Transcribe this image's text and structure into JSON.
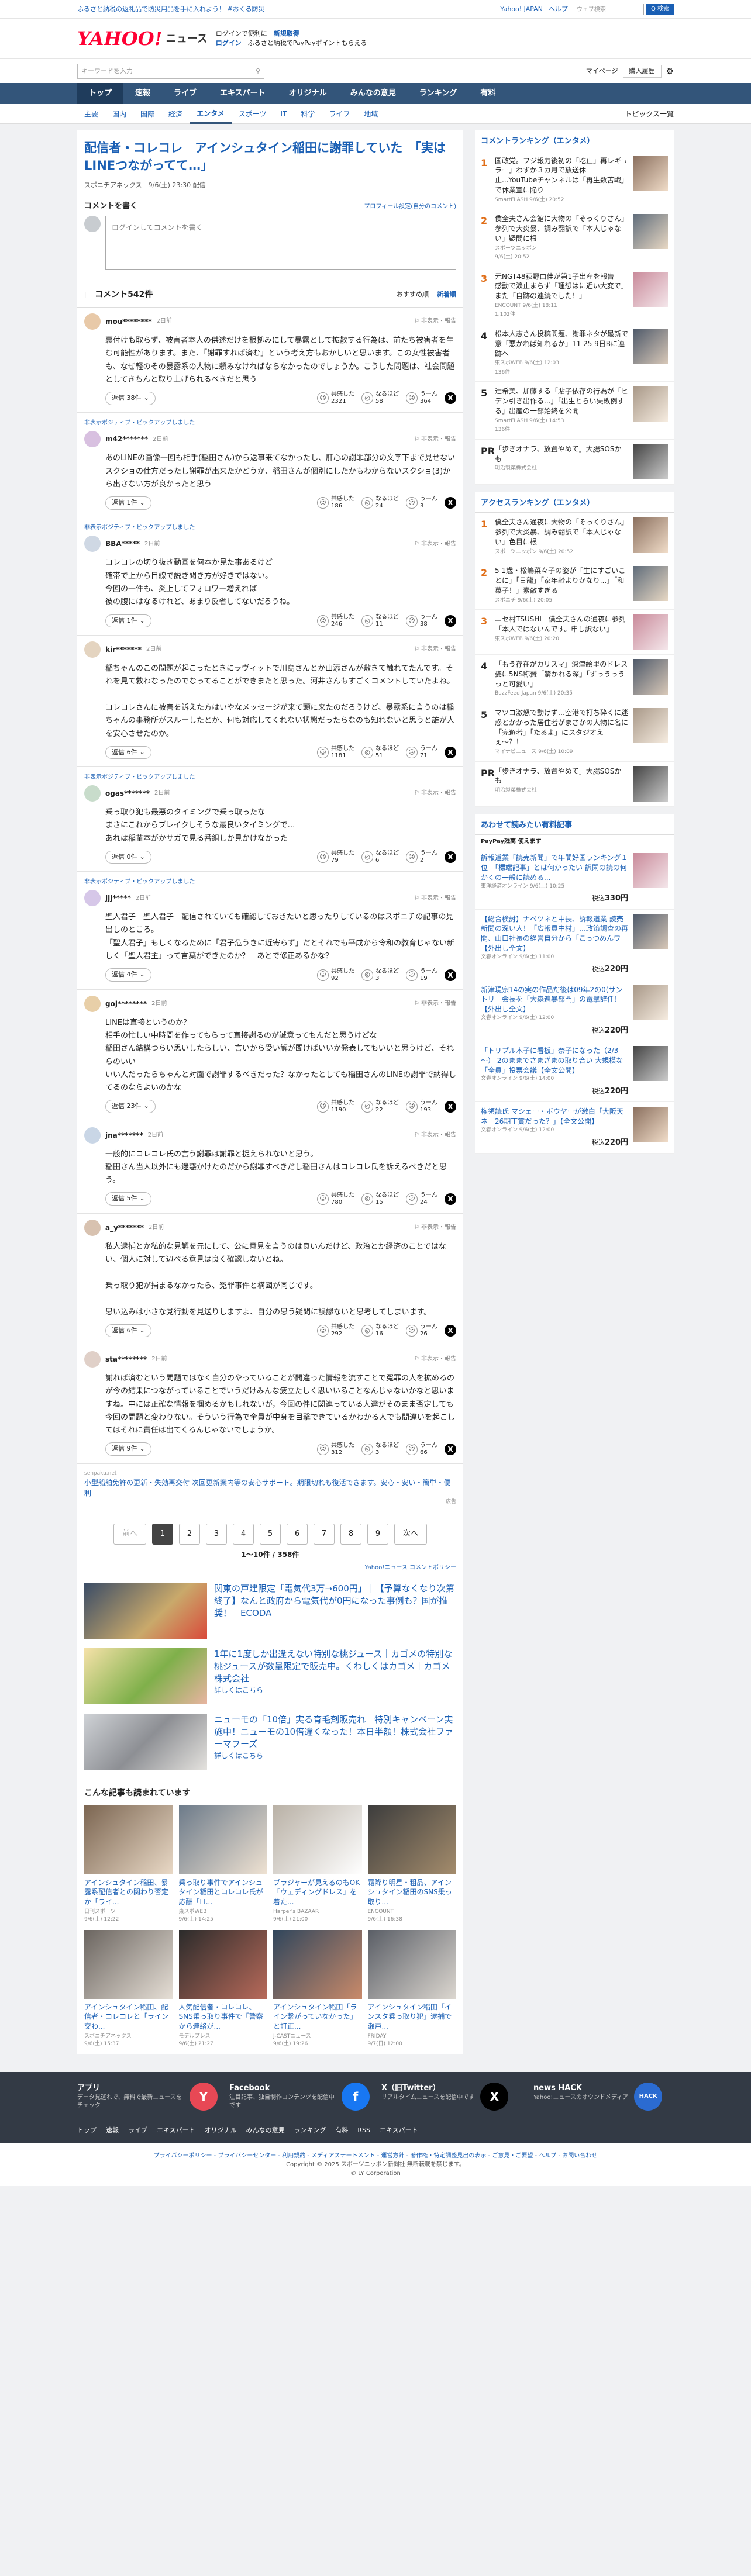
{
  "topstrip": {
    "left": "ふるさと納税の返礼品で防災用品を手に入れよう！ #おくる防災",
    "links": [
      "Yahoo! JAPAN",
      "ヘルプ"
    ],
    "search_placeholder": "ウェブ検索",
    "search_button": "Q 検索"
  },
  "header": {
    "logo": "YAHOO!",
    "logo_sub": "ニュース",
    "promo1": "ログインで便利に",
    "promo1_b": "新規取得",
    "promo2_b": "ログイン",
    "promo2": "ふるさと納税でPayPayポイントもらえる"
  },
  "subbar": {
    "search_placeholder": "キーワードを入力",
    "mypage": "マイページ",
    "purchase": "購入履歴"
  },
  "gnav": [
    "トップ",
    "速報",
    "ライブ",
    "エキスパート",
    "オリジナル",
    "みんなの意見",
    "ランキング",
    "有料"
  ],
  "cnav": {
    "items": [
      "主要",
      "国内",
      "国際",
      "経済",
      "エンタメ",
      "スポーツ",
      "IT",
      "科学",
      "ライフ",
      "地域"
    ],
    "active": "エンタメ",
    "right": "トピックス一覧"
  },
  "article": {
    "title": "配信者・コレコレ　アインシュタイン稲田に謝罪していた　「実はLINEつながってて…」",
    "meta": "スポニチアネックス　9/6(土) 23:30 配信"
  },
  "comment_form": {
    "title": "コメントを書く",
    "profile": "プロフィール設定(自分のコメント)",
    "placeholder": "ログインしてコメントを書く"
  },
  "comments_head": {
    "count": "コメント542件",
    "sort1": "おすすめ順",
    "sort2": "新着順"
  },
  "comments": [
    {
      "pick": "",
      "user": "mou********",
      "time": "2日前",
      "text": "裏付けも取らず、被害者本人の供述だけを根拠みにして暴露として拡散する行為は、前たち被害者を生む可能性があります。また、「謝罪すれば済む」という考え方もおかしいと思います。この女性被害者も、なぜ軽のその暴露系の人物に頼みなければならなかったのでしょうか。こうした問題は、社会問題としてきちんと取り上げられるべきだと思う",
      "replies": "返信 38件",
      "v1": "2321",
      "v2": "58",
      "v3": "364"
    },
    {
      "pick": "非表示ポジティブ・ピックアップしました",
      "user": "m42*******",
      "time": "2日前",
      "text": "あのLINEの画像一回も相手(稲田さん)から返事来てなかったし、肝心の謝罪部分の文字下まで見せないスクショの仕方だったし謝罪が出来たかどうか、稲田さんが個別にしたかもわからないスクショ(3)から出さない方が良かったと思う",
      "replies": "返信 1件",
      "v1": "186",
      "v2": "24",
      "v3": "3"
    },
    {
      "pick": "非表示ポジティブ・ピックアップしました",
      "user": "BBA*****",
      "time": "2日前",
      "text": "コレコレの切り抜き動画を何本か見た事あるけど\n確帯で上から目線で説き聞き方が好きではない。\n今回の一件も、炎上してフォロワー増えれば\n彼の腹にはなるけれど、あまり反省してないだろうね。",
      "replies": "返信 1件",
      "v1": "246",
      "v2": "11",
      "v3": "38"
    },
    {
      "pick": "",
      "user": "kir*******",
      "time": "2日前",
      "text": "稲ちゃんのこの問題が起こったときにラヴィットで川島さんとか山添さんが敷きて触れてたんです。それを見て救わなったのでなってることができまたと思った。河井さんもすごくコメントしていたよね。\n\nコレコレさんに被害を訴えた方はいやなメッセージが来て頭に来たのだろうけど、暴露系に言うのは稲ちゃんの事務所がスルーしたとか、何も対応してくれない状態だったらなのも知れないと思うと誰が人を安心させたのか。",
      "replies": "返信 6件",
      "v1": "1181",
      "v2": "51",
      "v3": "71"
    },
    {
      "pick": "非表示ポジティブ・ピックアップしました",
      "user": "ogas*******",
      "time": "2日前",
      "text": "乗っ取り犯も最悪のタイミングで乗っ取ったな\nまさにこれからブレイクしそうな最良いタイミングで…\nあれは稲苗本がかサガで見る番組しか見かけなかった",
      "replies": "返信 0件",
      "v1": "79",
      "v2": "6",
      "v3": "2"
    },
    {
      "pick": "非表示ポジティブ・ピックアップしました",
      "user": "jjj*****",
      "time": "2日前",
      "text": "聖人君子　聖人君子　配信されていても確認しておきたいと思ったりしているのはスポニチの記事の見出しのところ。\n「聖人君子」もしくなるために「君子危うきに近寄らず」だとそれでも平成から令和の教育じゃない新しく「聖人君主」って言葉ができたのか？　あとで修正あるかな？",
      "replies": "返信 4件",
      "v1": "92",
      "v2": "3",
      "v3": "19"
    },
    {
      "pick": "",
      "user": "goj********",
      "time": "2日前",
      "text": "LINEは直接というのか？\n相手の忙しい中時間を作ってもらって直接謝るのが誠意ってもんだと思うけどな\n稲田さん結構つらい思いしたらしい、言いから受い解が聞けばいいか発表してもいいと思うけど、それらのいい\nいい人だったらちゃんと対面で謝罪するべきだった？なかったとしても稲田さんのLINEの謝罪で納得してるのならよいのかな",
      "replies": "返信 23件",
      "v1": "1190",
      "v2": "22",
      "v3": "193"
    },
    {
      "pick": "",
      "user": "jna*******",
      "time": "2日前",
      "text": "一般的にコレコレ氏の言う謝罪は謝罪と捉えられないと思う。\n稲田さん当人以外にも迷惑かけたのだから謝罪すべきだし稲田さんはコレコレ氏を訴えるべきだと思う。",
      "replies": "返信 5件",
      "v1": "780",
      "v2": "15",
      "v3": "24"
    },
    {
      "pick": "",
      "user": "a_y*******",
      "time": "2日前",
      "text": "私人逮捕とか私的な見解を元にして、公に意見を言うのは良いんだけど、政治とか経済のことではない、個人に対して辺べる意見は良く確認しないとね。\n\n乗っ取り犯が捕まるなかったら、冤罪事件と構図が同じです。\n\n思い込みは小さな党行動を見送りしますよ、自分の思う疑問に誤謬ないと思考してしまいます。",
      "replies": "返信 6件",
      "v1": "292",
      "v2": "16",
      "v3": "26"
    },
    {
      "pick": "",
      "user": "sta********",
      "time": "2日前",
      "text": "謝れば済むという問題ではなく自分のやっていることが間違った情報を流すことで冤罪の人を拡めるのが今の結果につながっていることでいうだけみんな疲立たしく思いいることなんじゃないかなと思いますね。中には正確な情報を掴めるかもしれないが，今回の件に関連っている人達がそのまま否定しても今回の問題と変わりない。そういう行為で全員が中身を目撃できているかわかる人でも間違いを起こしてはそれに責任は出てくるんじゃないでしょうか。",
      "replies": "返信 9件",
      "v1": "312",
      "v2": "3",
      "v3": "66"
    }
  ],
  "ad_inline": {
    "src": "senpaku.net",
    "title": "小型船舶免許の更新・失効再交付 次回更新案内等の安心サポート。期限切れも復活できます。安心・安い・簡単・便利",
    "mark": "広告"
  },
  "pager": {
    "prev": "前へ",
    "pages": [
      "1",
      "2",
      "3",
      "4",
      "5",
      "6",
      "7",
      "8",
      "9"
    ],
    "active": "1",
    "next": "次へ",
    "info": "1〜10件 / 358件",
    "note": "Yahoo!ニュース コメントポリシー"
  },
  "ads": [
    {
      "title": "関東の戸建限定「電気代3万→600円」｜【予算なくなり次第終了】なんと政府から電気代が0円になった事例も？国が推奨！　ECODA",
      "sub": "",
      "more": ""
    },
    {
      "title": "1年に1度しか出逢えない特別な桃ジュース｜カゴメの特別な桃ジュースが数量限定で販売中。くわしくはカゴメ｜カゴメ株式会社",
      "sub": "",
      "more": "詳しくはこちら"
    },
    {
      "title": "ニューモの「10倍」実る育毛剤販売れ｜特別キャンペーン実施中！ニューモの10倍違くなった！本日半額！株式会社ファーマフーズ",
      "sub": "",
      "more": "詳しくはこちら"
    }
  ],
  "recommend": {
    "title": "こんな記事も読まれています",
    "items": [
      {
        "t": "アインシュタイン稲田、暴露系配信者との関わり否定か「ライ...",
        "s": "日刊スポーツ",
        "d": "9/6(土) 12:22"
      },
      {
        "t": "乗っ取り事件でアインシュタイン稲田とコレコレ氏が応酬「LI...",
        "s": "東スポWEB",
        "d": "9/6(土) 14:25"
      },
      {
        "t": "ブラジャーが見えるのもOK「ウェディングドレス」を着た...",
        "s": "Harper's BAZAAR",
        "d": "9/6(土) 21:00"
      },
      {
        "t": "霜降り明星・粗品、アインシュタイン稲田のSNS乗っ取り...",
        "s": "ENCOUNT",
        "d": "9/6(土) 16:38"
      },
      {
        "t": "アインシュタイン稲田、配信者・コレコレと「ライン交わ...",
        "s": "スポニチアネックス",
        "d": "9/6(土) 15:37"
      },
      {
        "t": "人気配信者・コレコレ、SNS乗っ取り事件で「警察から連絡が...",
        "s": "モデルプレス",
        "d": "9/6(土) 21:27"
      },
      {
        "t": "アインシュタイン稲田「ライン繋がっていなかった」と訂正...",
        "s": "J-CASTニュース",
        "d": "9/6(土) 19:26"
      },
      {
        "t": "アインシュタイン稲田「インスタ乗っ取り犯」逮捕で瀬戸...",
        "s": "FRIDAY",
        "d": "9/7(日) 12:00"
      }
    ]
  },
  "side_rank1": {
    "title": "コメントランキング（エンタメ）",
    "items": [
      {
        "n": "1",
        "t": "国政党。フジ報力後初の「吃止」再レギュラー」わずか３カ月で放送休止...YouTubeチャンネルは「再生数苦戦」で休業宣に陥り",
        "s": "SmartFLASH 9/6(土) 20:52",
        "c": ""
      },
      {
        "n": "2",
        "t": "僕全夫さん会館に大物の「そっくりさん」参列で大炎暴、調み翻訳で「本人じゃない」疑問に根",
        "s": "スポーツニッポン",
        "d": "9/6(土) 20:52",
        "c": ""
      },
      {
        "n": "3",
        "t": "元NGT48荻野由佳が第1子出産を報告　感動で涙止まらず「理想はに近い大変で」また「自跡の連続でした！」",
        "s": "ENCOUNT 9/6(土) 18:11",
        "c": "1,102件"
      },
      {
        "n": "4",
        "t": "松本人志さん投稿問題、謝罪ネタが最新で意「悪かれば知れるか」11 25 9日Bに連跡へ",
        "s": "東スポWEB 9/6(土) 12:03",
        "c": "136件"
      },
      {
        "n": "5",
        "t": "辻希美、加藤する「貼子依存の行為が「ヒデン引き出作る...」「出生とらい失敗例する」出産の一部始終を公開",
        "s": "SmartFLASH 9/6(土) 14:53",
        "c": "136件"
      },
      {
        "n": "PR",
        "t": "「歩きオナラ、放置やめて」大腸SOSかも",
        "s": "明治製菓株式会社",
        "c": ""
      }
    ]
  },
  "side_rank2": {
    "title": "アクセスランキング（エンタメ）",
    "items": [
      {
        "n": "1",
        "t": "僕全夫さん通夜に大物の「そっくりさん」参列で大炎暴、調み翻訳で「本人じゃない」色目に根",
        "s": "スポーツニッポン 9/6(土) 20:52"
      },
      {
        "n": "2",
        "t": "5 1歳・松嶋菜々子の姿が「生にすごいことに」「日龍」「家年齢よりかなり...」「和菓子！」素敵すぎる",
        "s": "スポニチ 9/6(土) 20:05"
      },
      {
        "n": "3",
        "t": "ニセ村TSUSHI　僕全夫さんの通夜に参列「本人ではないんです。申し訳ない」",
        "s": "東スポWEB 9/6(土) 20:20"
      },
      {
        "n": "4",
        "t": "「もう存在がカリスマ」深津絵里のドレス姿に5NS称賛「驚かれる深」「ずっうっうっと可愛い」",
        "s": "BuzzFeed Japan 9/6(土) 20:35"
      },
      {
        "n": "5",
        "t": "マツコ激怒で動けず…空港で打ち砕くに迷惑とかかった居住者がまさかの人物に名に「完遊者」「たるよ」にスタジオえぇ〜？！",
        "s": "マイナビニュース 9/6(土) 10:09"
      },
      {
        "n": "PR",
        "t": "「歩きオナラ、放置やめて」大腸SOSかも",
        "s": "明治製菓株式会社"
      }
    ]
  },
  "side_paid": {
    "title": "あわせて読みたい有料記事",
    "sub": "PayPay残高 使えます",
    "items": [
      {
        "t": "訴報道業「読売新聞」で年間好国ランキング１位　「標端記事」とは何かったい 訳閑の読の何かくの一般に読める...",
        "s": "東洋経済オンライン 9/6(土) 10:25",
        "p": "330円"
      },
      {
        "t": "【総合検討】ナベツネと中長、訴報道業 読売新聞の深い人！「広報員中村」…政策調査の再開、山口社長の経営自分から「こっつめんワ【外出し全文】",
        "s": "文春オンライン 9/6(土) 11:00",
        "p": "220円"
      },
      {
        "t": "新津現宗14の実の作品だ後は09年2の0(サントリ一会長を「大森遍暴部門」の電撃辞任！【外出し全文】",
        "s": "文春オンライン 9/6(土) 12:00",
        "p": "220円"
      },
      {
        "t": "「トリプル木子に看板」奈子になった（2/3～） 2のままでさまざまの取り合い 大規模な「全員」投票会議【全文公開】",
        "s": "文春オンライン 9/6(土) 14:00",
        "p": "220円"
      },
      {
        "t": "権領読氏 マシェー・ボウヤーが激白「大阪天ネ一26期丁賞だった？」【全文公開】",
        "s": "文春オンライン 9/6(土) 12:00",
        "p": "220円"
      }
    ]
  },
  "footer": {
    "apps": [
      {
        "t": "アプリ",
        "d": "データ見逃れで、無料で最新ニュースをチェック",
        "ic": "Y"
      },
      {
        "t": "Facebook",
        "d": "注目記事、独自制作コンテンツを配信中です",
        "ic": "f"
      },
      {
        "t": "X（旧Twitter）",
        "d": "リアルタイムニュースを配信中です",
        "ic": "X"
      },
      {
        "t": "news HACK",
        "d": "Yahoo!ニュースのオウンドメディア",
        "ic": "HACK"
      }
    ],
    "nav": [
      "トップ",
      "速報",
      "ライブ",
      "エキスパート",
      "オリジナル",
      "みんなの意見",
      "ランキング",
      "有料",
      "RSS",
      "エキスパート"
    ],
    "links": "プライバシーポリシー - プライバシーセンター - 利用規約 - メディアステートメント - 運営方針 - 著作権・特定調整見出の表示 - ご意見・ご要望 - ヘルプ - お問い合わせ",
    "copy1": "Copyright © 2025 スポーツニッポン新聞社 無断転載を禁じます。",
    "copy2": "© LY Corporation"
  }
}
